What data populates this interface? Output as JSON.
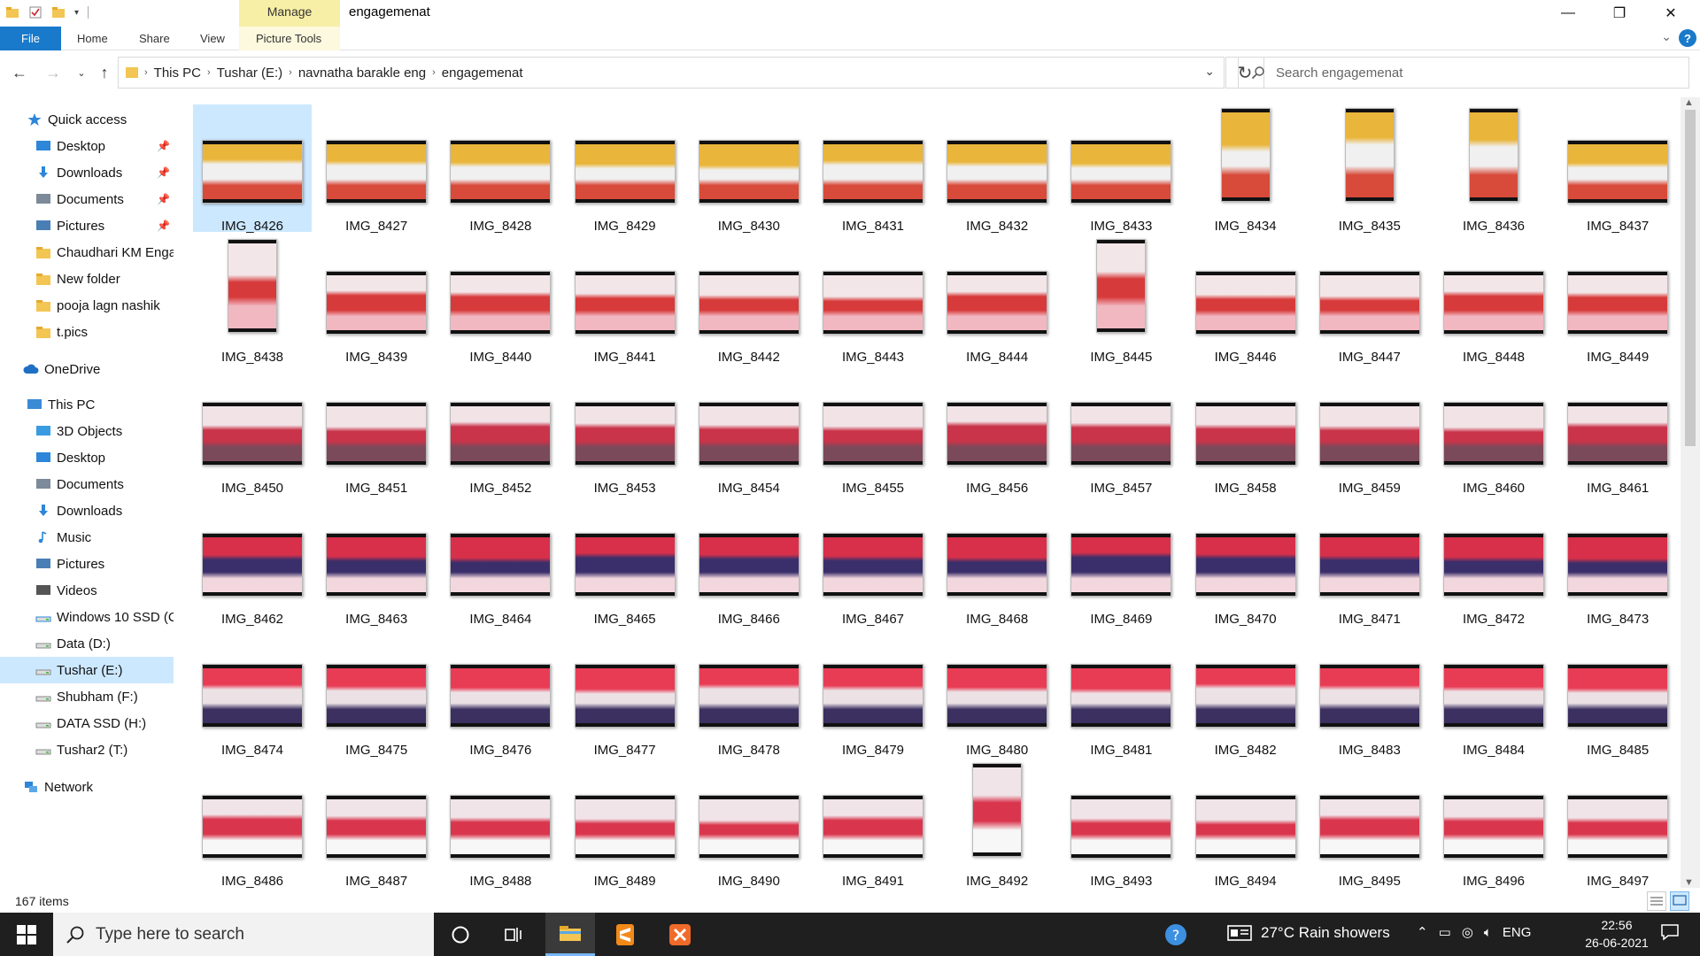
{
  "window": {
    "title": "engagemenat",
    "contextual_tab_group": "Manage",
    "controls": [
      "—",
      "❐",
      "✕"
    ]
  },
  "ribbon": {
    "tabs": [
      "File",
      "Home",
      "Share",
      "View",
      "Picture Tools"
    ],
    "help_label": "?"
  },
  "address": {
    "crumbs": [
      "This PC",
      "Tushar (E:)",
      "navnatha barakle eng",
      "engagemenat"
    ]
  },
  "search": {
    "placeholder": "Search engagemenat"
  },
  "navpane": {
    "items": [
      {
        "label": "Quick access",
        "icon": "star-icon",
        "pinned": false
      },
      {
        "label": "Desktop",
        "icon": "desktop-icon",
        "pinned": true
      },
      {
        "label": "Downloads",
        "icon": "download-arrow-icon",
        "pinned": true
      },
      {
        "label": "Documents",
        "icon": "documents-icon",
        "pinned": true
      },
      {
        "label": "Pictures",
        "icon": "pictures-icon",
        "pinned": true
      },
      {
        "label": "Chaudhari KM Enga",
        "icon": "folder-icon",
        "pinned": false
      },
      {
        "label": "New folder",
        "icon": "folder-icon",
        "pinned": false
      },
      {
        "label": "pooja lagn nashik",
        "icon": "folder-icon",
        "pinned": false
      },
      {
        "label": "t.pics",
        "icon": "folder-icon",
        "pinned": false
      },
      {
        "label": "OneDrive",
        "icon": "cloud-icon",
        "pinned": false
      },
      {
        "label": "This PC",
        "icon": "computer-icon",
        "pinned": false
      },
      {
        "label": "3D Objects",
        "icon": "cube-icon",
        "pinned": false
      },
      {
        "label": "Desktop",
        "icon": "desktop-icon",
        "pinned": false
      },
      {
        "label": "Documents",
        "icon": "documents-icon",
        "pinned": false
      },
      {
        "label": "Downloads",
        "icon": "download-arrow-icon",
        "pinned": false
      },
      {
        "label": "Music",
        "icon": "music-note-icon",
        "pinned": false
      },
      {
        "label": "Pictures",
        "icon": "pictures-icon",
        "pinned": false
      },
      {
        "label": "Videos",
        "icon": "film-icon",
        "pinned": false
      },
      {
        "label": "Windows 10 SSD (C",
        "icon": "windows-drive-icon",
        "pinned": false
      },
      {
        "label": "Data (D:)",
        "icon": "drive-icon",
        "pinned": false
      },
      {
        "label": "Tushar (E:)",
        "icon": "drive-icon",
        "pinned": false
      },
      {
        "label": "Shubham (F:)",
        "icon": "drive-icon",
        "pinned": false
      },
      {
        "label": "DATA SSD (H:)",
        "icon": "drive-icon",
        "pinned": false
      },
      {
        "label": "Tushar2 (T:)",
        "icon": "drive-icon",
        "pinned": false
      },
      {
        "label": "Network",
        "icon": "network-icon",
        "pinned": false
      }
    ],
    "pin_glyph": "📌",
    "selected_label": "Tushar (E:)"
  },
  "files": {
    "selected": "IMG_8426",
    "portrait": [
      "IMG_8434",
      "IMG_8435",
      "IMG_8436",
      "IMG_8438",
      "IMG_8445",
      "IMG_8492"
    ],
    "names": [
      "IMG_8426",
      "IMG_8427",
      "IMG_8428",
      "IMG_8429",
      "IMG_8430",
      "IMG_8431",
      "IMG_8432",
      "IMG_8433",
      "IMG_8434",
      "IMG_8435",
      "IMG_8436",
      "IMG_8437",
      "IMG_8438",
      "IMG_8439",
      "IMG_8440",
      "IMG_8441",
      "IMG_8442",
      "IMG_8443",
      "IMG_8444",
      "IMG_8445",
      "IMG_8446",
      "IMG_8447",
      "IMG_8448",
      "IMG_8449",
      "IMG_8450",
      "IMG_8451",
      "IMG_8452",
      "IMG_8453",
      "IMG_8454",
      "IMG_8455",
      "IMG_8456",
      "IMG_8457",
      "IMG_8458",
      "IMG_8459",
      "IMG_8460",
      "IMG_8461",
      "IMG_8462",
      "IMG_8463",
      "IMG_8464",
      "IMG_8465",
      "IMG_8466",
      "IMG_8467",
      "IMG_8468",
      "IMG_8469",
      "IMG_8470",
      "IMG_8471",
      "IMG_8472",
      "IMG_8473",
      "IMG_8474",
      "IMG_8475",
      "IMG_8476",
      "IMG_8477",
      "IMG_8478",
      "IMG_8479",
      "IMG_8480",
      "IMG_8481",
      "IMG_8482",
      "IMG_8483",
      "IMG_8484",
      "IMG_8485",
      "IMG_8486",
      "IMG_8487",
      "IMG_8488",
      "IMG_8489",
      "IMG_8490",
      "IMG_8491",
      "IMG_8492",
      "IMG_8493",
      "IMG_8494",
      "IMG_8495",
      "IMG_8496",
      "IMG_8497"
    ],
    "row_palettes": [
      [
        "#e9b53a",
        "#f0f0f0",
        "#d84a3a"
      ],
      [
        "#f3e6e8",
        "#d73a3a",
        "#f2b8c2"
      ],
      [
        "#f1e3e6",
        "#c9344a",
        "#7a4a5a"
      ],
      [
        "#d8304a",
        "#3a2f6a",
        "#f3d7de"
      ],
      [
        "#e83c55",
        "#ece2e6",
        "#3b3060"
      ],
      [
        "#f0e4e8",
        "#d9364d",
        "#f7f7f7"
      ]
    ]
  },
  "status": {
    "item_count": "167 items"
  },
  "taskbar": {
    "search_placeholder": "Type here to search",
    "weather": "27°C  Rain showers",
    "language": "ENG",
    "time": "22:56",
    "date": "26-06-2021"
  },
  "colors": {
    "accent": "#1979ca",
    "selection": "#cce8ff",
    "manage_band": "#f8efa6",
    "taskbar": "#1f1f1f"
  }
}
